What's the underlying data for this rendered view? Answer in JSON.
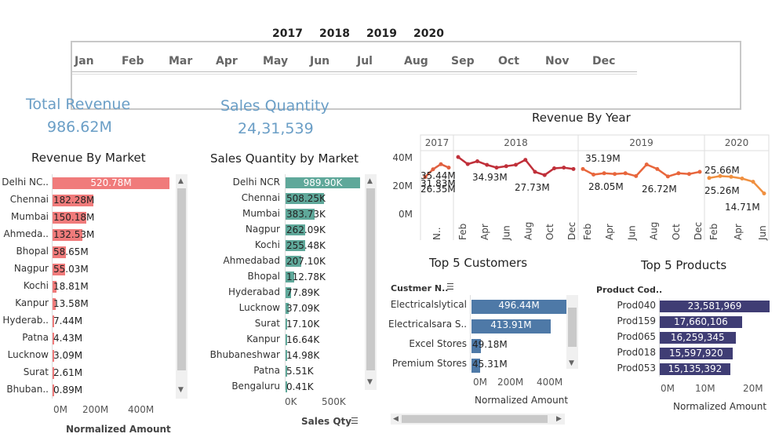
{
  "filters": {
    "years": [
      "2017",
      "2018",
      "2019",
      "2020"
    ],
    "months": [
      "Jan",
      "Feb",
      "Mar",
      "Apr",
      "May",
      "Jun",
      "Jul",
      "Aug",
      "Sep",
      "Oct",
      "Nov",
      "Dec"
    ]
  },
  "kpis": {
    "revenue": {
      "title": "Total Revenue",
      "value": "986.62M"
    },
    "quantity": {
      "title": "Sales Quantity",
      "value": "24,31,539"
    }
  },
  "revenue_by_market": {
    "title": "Revenue By Market",
    "axis_title": "Normalized Amount",
    "ticks": [
      "0M",
      "200M",
      "400M"
    ],
    "labels": [
      "Delhi NC..",
      "Chennai",
      "Mumbai",
      "Ahmeda..",
      "Bhopal",
      "Nagpur",
      "Kochi",
      "Kanpur",
      "Hyderab..",
      "Patna",
      "Lucknow",
      "Surat",
      "Bhuban.."
    ],
    "value_labels": [
      "520.78M",
      "182.28M",
      "150.18M",
      "132.53M",
      "58.65M",
      "55.03M",
      "18.81M",
      "13.58M",
      "7.44M",
      "4.43M",
      "3.09M",
      "2.61M",
      "0.89M"
    ],
    "values": [
      520.78,
      182.28,
      150.18,
      132.53,
      58.65,
      55.03,
      18.81,
      13.58,
      7.44,
      4.43,
      3.09,
      2.61,
      0.89
    ],
    "color": "#f07b7b"
  },
  "qty_by_market": {
    "title": "Sales Quantity by Market",
    "axis_title": "Sales Qty",
    "ticks": [
      "0K",
      "500K"
    ],
    "labels": [
      "Delhi NCR",
      "Chennai",
      "Mumbai",
      "Nagpur",
      "Kochi",
      "Ahmedabad",
      "Bhopal",
      "Hyderabad",
      "Lucknow",
      "Surat",
      "Kanpur",
      "Bhubaneshwar",
      "Patna",
      "Bengaluru"
    ],
    "value_labels": [
      "989.90K",
      "508.25K",
      "383.73K",
      "262.09K",
      "255.48K",
      "207.10K",
      "112.78K",
      "77.89K",
      "37.09K",
      "17.10K",
      "16.64K",
      "14.98K",
      "5.51K",
      "0.41K"
    ],
    "values": [
      989.9,
      508.25,
      383.73,
      262.09,
      255.48,
      207.1,
      112.78,
      77.89,
      37.09,
      17.1,
      16.64,
      14.98,
      5.51,
      0.41
    ],
    "color": "#5fa89a"
  },
  "revenue_by_year": {
    "title": "Revenue By Year",
    "y_ticks": [
      "40M",
      "20M",
      "0M"
    ],
    "years": [
      "2017",
      "2018",
      "2019",
      "2020"
    ],
    "months_2017": [
      "N.."
    ],
    "months_2018": [
      "Feb",
      "Apr",
      "Jun",
      "Aug",
      "Oct",
      "Dec"
    ],
    "months_2019": [
      "Feb",
      "Apr",
      "Jun",
      "Aug",
      "Oct",
      "Dec"
    ],
    "months_2020": [
      "Feb",
      "Apr",
      "Jun"
    ],
    "labels": [
      {
        "text": "31.83M"
      },
      {
        "text": "35.44M"
      },
      {
        "text": "26.35M"
      },
      {
        "text": "34.93M"
      },
      {
        "text": "27.73M"
      },
      {
        "text": "35.19M"
      },
      {
        "text": "28.05M"
      },
      {
        "text": "26.72M"
      },
      {
        "text": "25.66M"
      },
      {
        "text": "25.26M"
      },
      {
        "text": "14.71M"
      }
    ]
  },
  "chart_data": {
    "type": "line",
    "ylim": [
      0,
      45
    ],
    "series": [
      {
        "year": "2017",
        "values": [
          26.35,
          31.83,
          35.44,
          33.0
        ]
      },
      {
        "year": "2018",
        "values": [
          40.5,
          35.5,
          37.5,
          34.93,
          33.0,
          34.0,
          35.0,
          38.5,
          30.0,
          27.73,
          32.5,
          33.0,
          32.0
        ]
      },
      {
        "year": "2019",
        "values": [
          32.0,
          28.05,
          29.0,
          28.5,
          29.0,
          27.0,
          35.19,
          32.0,
          26.72,
          29.0,
          28.5,
          30.0
        ]
      },
      {
        "year": "2020",
        "values": [
          25.66,
          27.0,
          26.5,
          25.26,
          23.0,
          14.71
        ]
      }
    ]
  },
  "top_customers": {
    "title": "Top 5 Customers",
    "header": "Custmer N..",
    "axis_title": "Normalized Amount",
    "ticks": [
      "0M",
      "200M",
      "400M"
    ],
    "labels": [
      "Electricalslytical",
      "Electricalsara S..",
      "Excel Stores",
      "Premium Stores"
    ],
    "value_labels": [
      "496.44M",
      "413.91M",
      "49.18M",
      "45.31M"
    ],
    "values": [
      496.44,
      413.91,
      49.18,
      45.31
    ],
    "color": "#4e79a7"
  },
  "top_products": {
    "title": "Top 5 Products",
    "header": "Product Cod..",
    "axis_title": "Normalized Amount",
    "ticks": [
      "0M",
      "10M",
      "20M"
    ],
    "labels": [
      "Prod040",
      "Prod159",
      "Prod065",
      "Prod018",
      "Prod053"
    ],
    "value_labels": [
      "23,581,969",
      "17,660,106",
      "16,259,345",
      "15,597,920",
      "15,135,392"
    ],
    "values": [
      23581969,
      17660106,
      16259345,
      15597920,
      15135392
    ],
    "color": "#3f3d74"
  }
}
